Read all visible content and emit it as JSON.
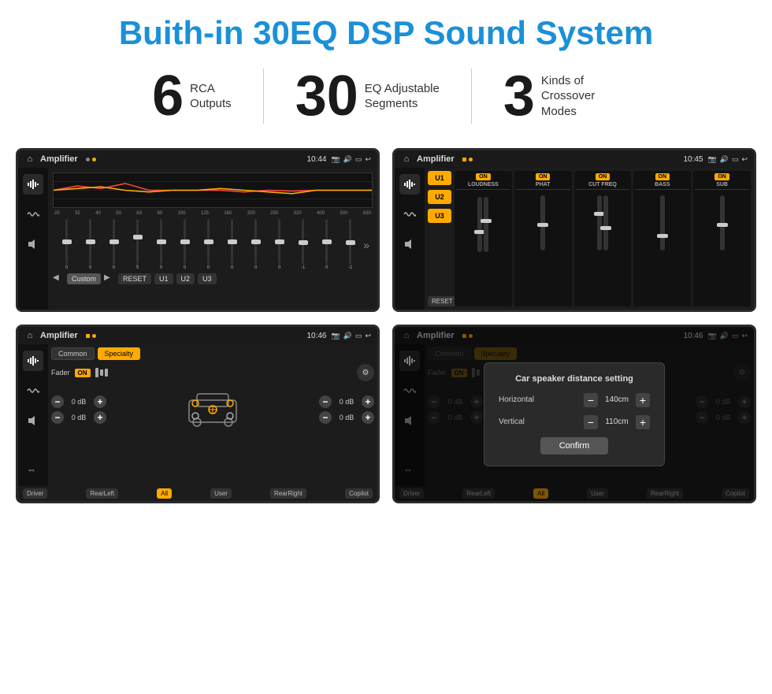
{
  "header": {
    "title": "Buith-in 30EQ DSP Sound System"
  },
  "stats": [
    {
      "number": "6",
      "label": "RCA\nOutputs"
    },
    {
      "number": "30",
      "label": "EQ Adjustable\nSegments"
    },
    {
      "number": "3",
      "label": "Kinds of\nCrossover Modes"
    }
  ],
  "screens": [
    {
      "id": "screen1",
      "status_bar": {
        "app": "Amplifier",
        "time": "10:44"
      },
      "type": "eq"
    },
    {
      "id": "screen2",
      "status_bar": {
        "app": "Amplifier",
        "time": "10:45"
      },
      "type": "amp"
    },
    {
      "id": "screen3",
      "status_bar": {
        "app": "Amplifier",
        "time": "10:46"
      },
      "type": "crossover"
    },
    {
      "id": "screen4",
      "status_bar": {
        "app": "Amplifier",
        "time": "10:46"
      },
      "type": "crossover_dialog"
    }
  ],
  "eq": {
    "frequencies": [
      "25",
      "32",
      "40",
      "50",
      "63",
      "80",
      "100",
      "125",
      "160",
      "200",
      "250",
      "320",
      "400",
      "500",
      "630"
    ],
    "values": [
      "0",
      "0",
      "0",
      "5",
      "0",
      "0",
      "0",
      "0",
      "0",
      "0",
      "-1",
      "0",
      "-1"
    ],
    "buttons": [
      "Custom",
      "RESET",
      "U1",
      "U2",
      "U3"
    ]
  },
  "amp": {
    "presets": [
      "U1",
      "U2",
      "U3"
    ],
    "channels": [
      {
        "name": "LOUDNESS",
        "on": true
      },
      {
        "name": "PHAT",
        "on": true
      },
      {
        "name": "CUT FREQ",
        "on": true
      },
      {
        "name": "BASS",
        "on": true
      },
      {
        "name": "SUB",
        "on": true
      }
    ],
    "reset_label": "RESET"
  },
  "crossover": {
    "tabs": [
      "Common",
      "Specialty"
    ],
    "fader_label": "Fader",
    "fader_on": "ON",
    "volumes": [
      "0 dB",
      "0 dB",
      "0 dB",
      "0 dB"
    ],
    "bottom_buttons": [
      "Driver",
      "RearLeft",
      "All",
      "User",
      "RearRight",
      "Copilot"
    ]
  },
  "dialog": {
    "title": "Car speaker distance setting",
    "horizontal_label": "Horizontal",
    "horizontal_value": "140cm",
    "vertical_label": "Vertical",
    "vertical_value": "110cm",
    "confirm_label": "Confirm"
  }
}
